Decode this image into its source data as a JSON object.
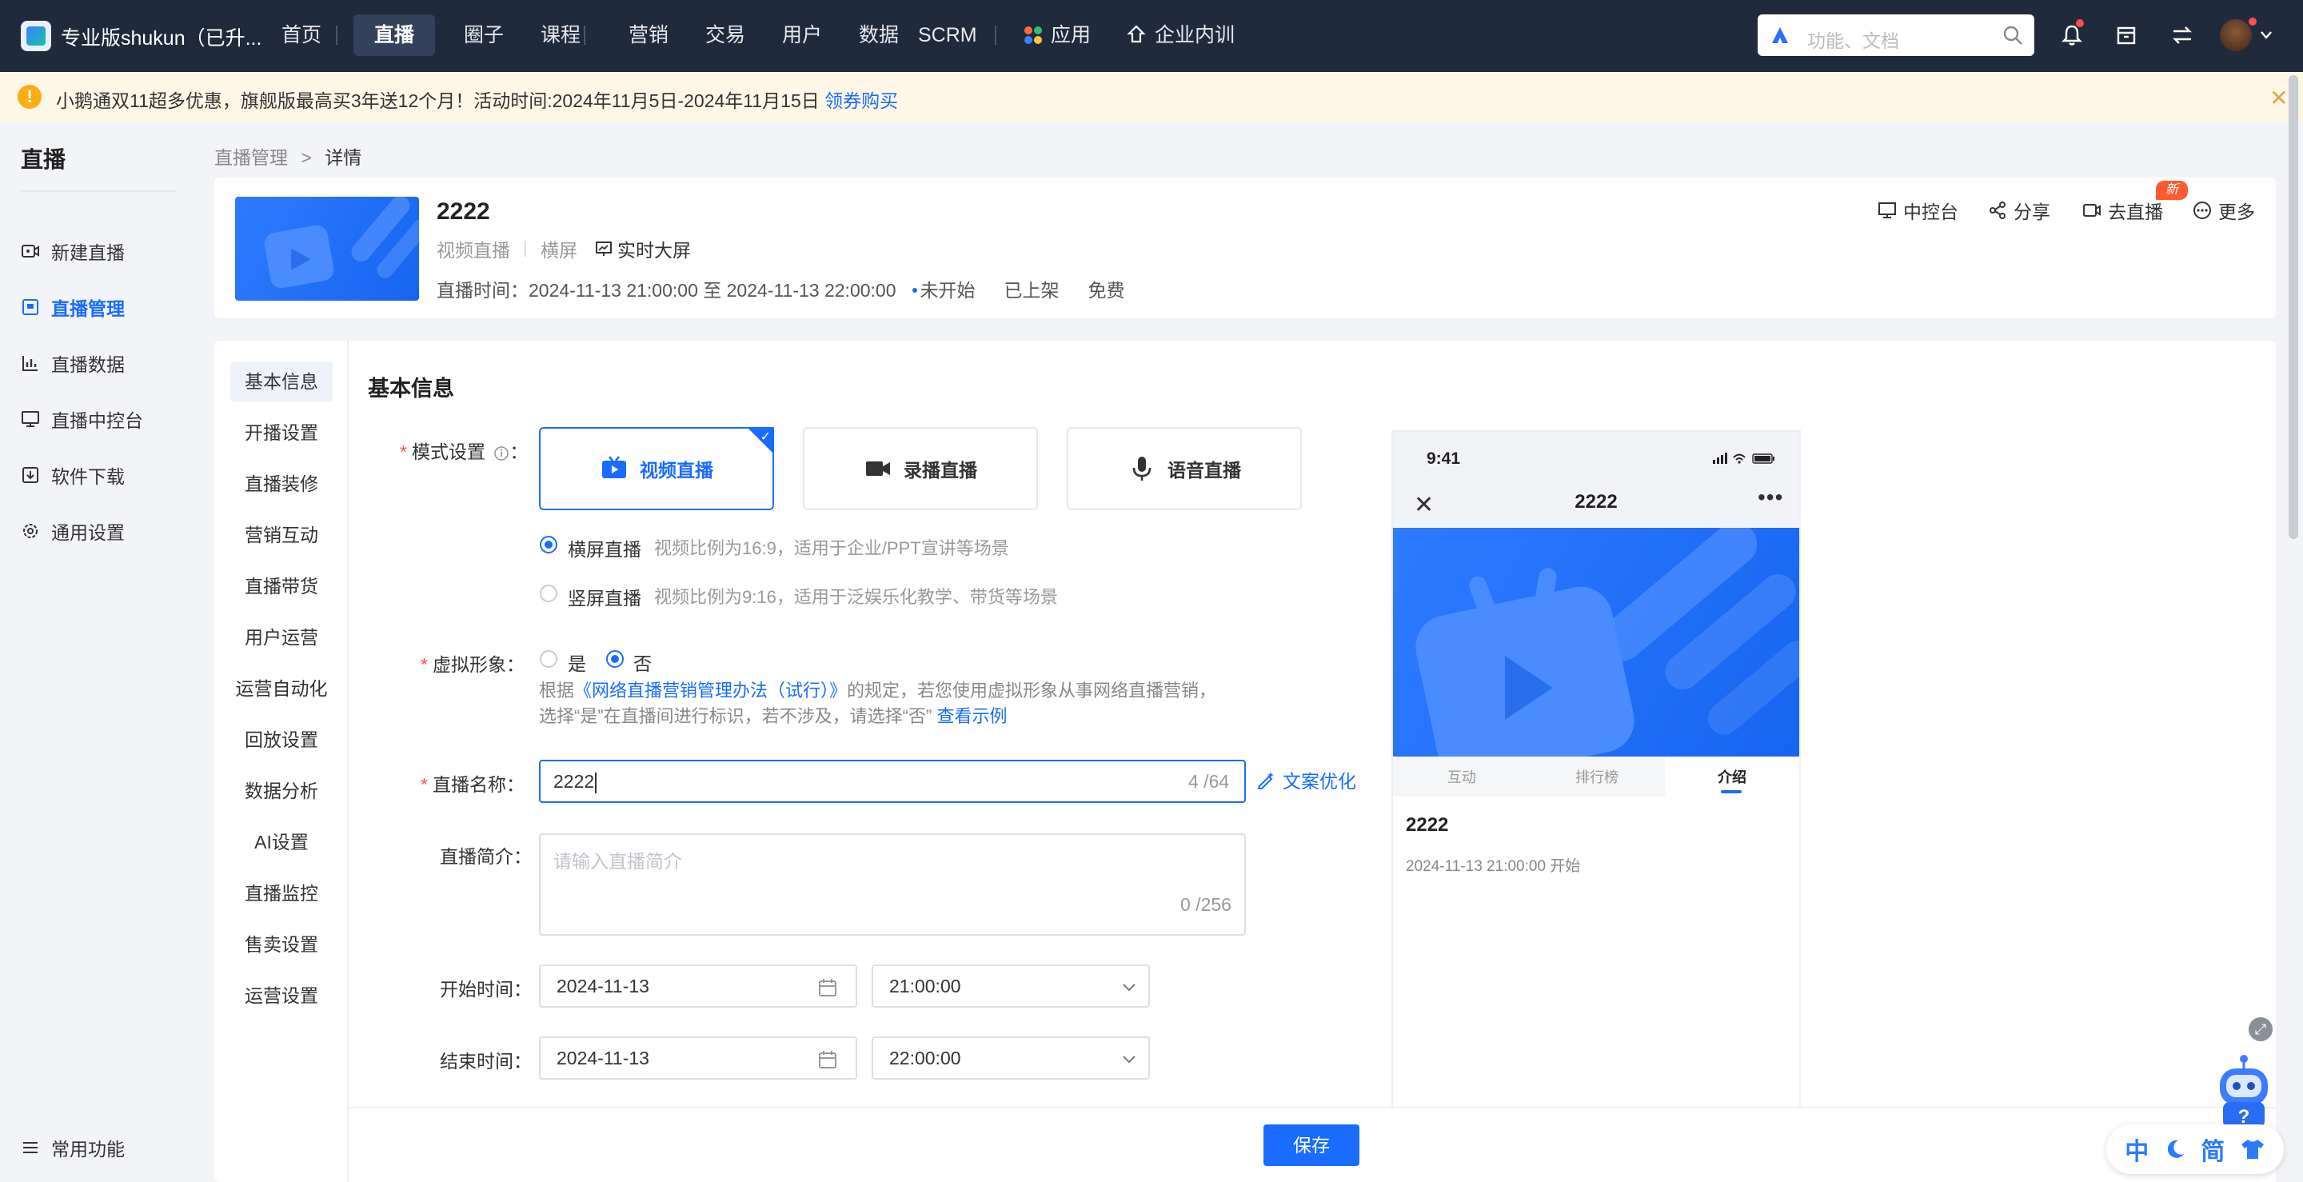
{
  "topbar": {
    "brand": "专业版shukun（已升...",
    "nav": [
      "首页",
      "直播",
      "圈子",
      "课程",
      "营销",
      "交易",
      "用户",
      "数据",
      "SCRM",
      "应用",
      "企业内训"
    ],
    "active_nav": "直播",
    "search_placeholder": "功能、文档",
    "icons": [
      "bell-icon",
      "store-icon",
      "switch-icon",
      "avatar"
    ]
  },
  "notice": {
    "text": "小鹅通双11超多优惠，旗舰版最高买3年送12个月！活动时间:2024年11月5日-2024年11月15日 ",
    "link": "领券购买",
    "color": "#fff7e6"
  },
  "sidebar": {
    "title": "直播",
    "items": [
      {
        "label": "新建直播",
        "icon": "live-new-icon"
      },
      {
        "label": "直播管理",
        "icon": "live-manage-icon",
        "active": true
      },
      {
        "label": "直播数据",
        "icon": "chart-icon"
      },
      {
        "label": "直播中控台",
        "icon": "monitor-icon"
      },
      {
        "label": "软件下载",
        "icon": "download-icon"
      },
      {
        "label": "通用设置",
        "icon": "gear-icon"
      }
    ],
    "footer": "常用功能"
  },
  "breadcrumb": {
    "parent": "直播管理",
    "sep": ">",
    "current": "详情"
  },
  "header": {
    "title": "2222",
    "type": "视频直播",
    "orientation": "横屏",
    "screen": "实时大屏",
    "time_label": "直播时间：",
    "time_value": "2024-11-13 21:00:00 至 2024-11-13 22:00:00",
    "status": "未开始",
    "shelf": "已上架",
    "price": "免费",
    "actions": [
      "中控台",
      "分享",
      "去直播",
      "更多"
    ],
    "new_badge": "新"
  },
  "tabs": [
    "基本信息",
    "开播设置",
    "直播装修",
    "营销互动",
    "直播带货",
    "用户运营",
    "运营自动化",
    "回放设置",
    "数据分析",
    "AI设置",
    "直播监控",
    "售卖设置",
    "运营设置"
  ],
  "form": {
    "section_title": "基本信息",
    "mode_label": "模式设置",
    "modes": [
      "视频直播",
      "录播直播",
      "语音直播"
    ],
    "orientation_options": [
      {
        "label": "横屏直播",
        "hint": "视频比例为16:9，适用于企业/PPT宣讲等场景",
        "checked": true
      },
      {
        "label": "竖屏直播",
        "hint": "视频比例为9:16，适用于泛娱乐化教学、带货等场景",
        "checked": false
      }
    ],
    "avatar_label": "虚拟形象",
    "avatar_options": [
      {
        "label": "是",
        "checked": false
      },
      {
        "label": "否",
        "checked": true
      }
    ],
    "avatar_note_1": "根据",
    "avatar_note_link": "《网络直播营销管理办法（试行）》",
    "avatar_note_2": "的规定，若您使用虚拟形象从事网络直播营销，选择“是”在直播间进行标识，若不涉及，请选择“否”",
    "avatar_note_link2": "查看示例",
    "name_label": "直播名称",
    "name_value": "2222",
    "name_count": "4 /64",
    "optimize": "文案优化",
    "intro_label": "直播简介",
    "intro_placeholder": "请输入直播简介",
    "intro_count": "0 /256",
    "start_label": "开始时间",
    "start_date": "2024-11-13",
    "start_time": "21:00:00",
    "end_label": "结束时间",
    "end_date": "2024-11-13",
    "end_time": "22:00:00",
    "colon": "：",
    "save": "保存"
  },
  "preview": {
    "clock": "9:41",
    "title": "2222",
    "tabs": [
      "互动",
      "排行榜",
      "介绍"
    ],
    "name": "2222",
    "start": "2024-11-13 21:00:00 开始"
  },
  "ime": [
    "中",
    "简"
  ],
  "colors": {
    "accent": "#1a6cff",
    "topbar": "#1f2a3d"
  }
}
